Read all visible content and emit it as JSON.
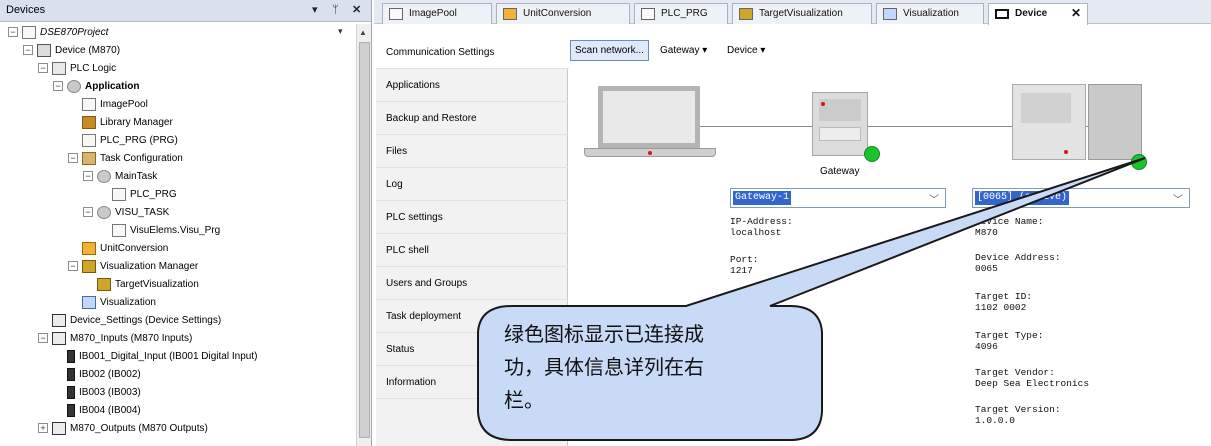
{
  "devices_panel": {
    "title": "Devices",
    "pin_glyph": "▾  ᛘ  ✕",
    "tree": [
      {
        "label": "DSE870Project",
        "indent": 0,
        "icon": "doc",
        "exp": "−",
        "italic": true
      },
      {
        "label": "Device (M870)",
        "indent": 1,
        "icon": "dev",
        "exp": "−"
      },
      {
        "label": "PLC Logic",
        "indent": 2,
        "icon": "folder",
        "exp": "−"
      },
      {
        "label": "Application",
        "indent": 3,
        "icon": "gear",
        "exp": "−",
        "bold": true
      },
      {
        "label": "ImagePool",
        "indent": 4,
        "icon": "doc"
      },
      {
        "label": "Library Manager",
        "indent": 4,
        "icon": "lib"
      },
      {
        "label": "PLC_PRG (PRG)",
        "indent": 4,
        "icon": "doc"
      },
      {
        "label": "Task Configuration",
        "indent": 4,
        "icon": "task",
        "exp": "−"
      },
      {
        "label": "MainTask",
        "indent": 5,
        "icon": "gear",
        "exp": "−"
      },
      {
        "label": "PLC_PRG",
        "indent": 6,
        "icon": "doc"
      },
      {
        "label": "VISU_TASK",
        "indent": 5,
        "icon": "gear",
        "exp": "−"
      },
      {
        "label": "VisuElems.Visu_Prg",
        "indent": 6,
        "icon": "doc"
      },
      {
        "label": "UnitConversion",
        "indent": 4,
        "icon": "unit"
      },
      {
        "label": "Visualization Manager",
        "indent": 4,
        "icon": "visumgr",
        "exp": "−"
      },
      {
        "label": "TargetVisualization",
        "indent": 5,
        "icon": "visumgr"
      },
      {
        "label": "Visualization",
        "indent": 4,
        "icon": "visu"
      },
      {
        "label": "Device_Settings (Device Settings)",
        "indent": 2,
        "icon": "chip"
      },
      {
        "label": "M870_Inputs (M870 Inputs)",
        "indent": 2,
        "icon": "chip",
        "exp": "−"
      },
      {
        "label": "IB001_Digital_Input (IB001 Digital Input)",
        "indent": 3,
        "icon": "io"
      },
      {
        "label": "IB002 (IB002)",
        "indent": 3,
        "icon": "io"
      },
      {
        "label": "IB003 (IB003)",
        "indent": 3,
        "icon": "io"
      },
      {
        "label": "IB004 (IB004)",
        "indent": 3,
        "icon": "io"
      },
      {
        "label": "M870_Outputs (M870 Outputs)",
        "indent": 2,
        "icon": "chip",
        "exp": "+"
      }
    ]
  },
  "tabs": [
    {
      "label": "ImagePool",
      "icon": "imagepool-icon"
    },
    {
      "label": "UnitConversion",
      "icon": "unitconversion-icon"
    },
    {
      "label": "PLC_PRG",
      "icon": "plc-prg-icon"
    },
    {
      "label": "TargetVisualization",
      "icon": "targetvisualization-icon"
    },
    {
      "label": "Visualization",
      "icon": "visualization-icon"
    },
    {
      "label": "Device",
      "icon": "device-icon",
      "active": true,
      "close": "✕"
    }
  ],
  "side_nav": [
    {
      "label": "Communication Settings",
      "active": true
    },
    {
      "label": "Applications"
    },
    {
      "label": "Backup and Restore"
    },
    {
      "label": "Files"
    },
    {
      "label": "Log"
    },
    {
      "label": "PLC settings"
    },
    {
      "label": "PLC shell"
    },
    {
      "label": "Users and Groups"
    },
    {
      "label": "Task deployment"
    },
    {
      "label": "Status"
    },
    {
      "label": "Information"
    }
  ],
  "toolbar": {
    "scan_label": "Scan network...",
    "gateway_label": "Gateway ▾",
    "device_label": "Device ▾"
  },
  "gateway": {
    "label": "Gateway",
    "combo_value": "Gateway-1",
    "combo_arrow": "﹀",
    "ip_label": "IP-Address:",
    "ip_value": "localhost",
    "port_label": "Port:",
    "port_value": "1217"
  },
  "device": {
    "combo_value": "[0065] (active)",
    "combo_arrow": "﹀",
    "name_label": "Device Name:",
    "name_value": "M870",
    "address_label": "Device Address:",
    "address_value": "0065",
    "target_id_label": "Target ID:",
    "target_id_value": "1102  0002",
    "target_type_label": "Target Type:",
    "target_type_value": "4096",
    "vendor_label": "Target Vendor:",
    "vendor_value": "Deep Sea Electronics",
    "version_label": "Target Version:",
    "version_value": "1.0.0.0"
  },
  "callout": {
    "line1": "绿色图标显示已连接成",
    "line2": "功，具体信息详列在右",
    "line3": "栏。",
    "fill": "#c8daf5",
    "stroke": "#1a1a1a"
  },
  "colors": {
    "status_green": "#1ec22e",
    "selection_blue": "#3366cc",
    "led_red": "#dd1111"
  }
}
